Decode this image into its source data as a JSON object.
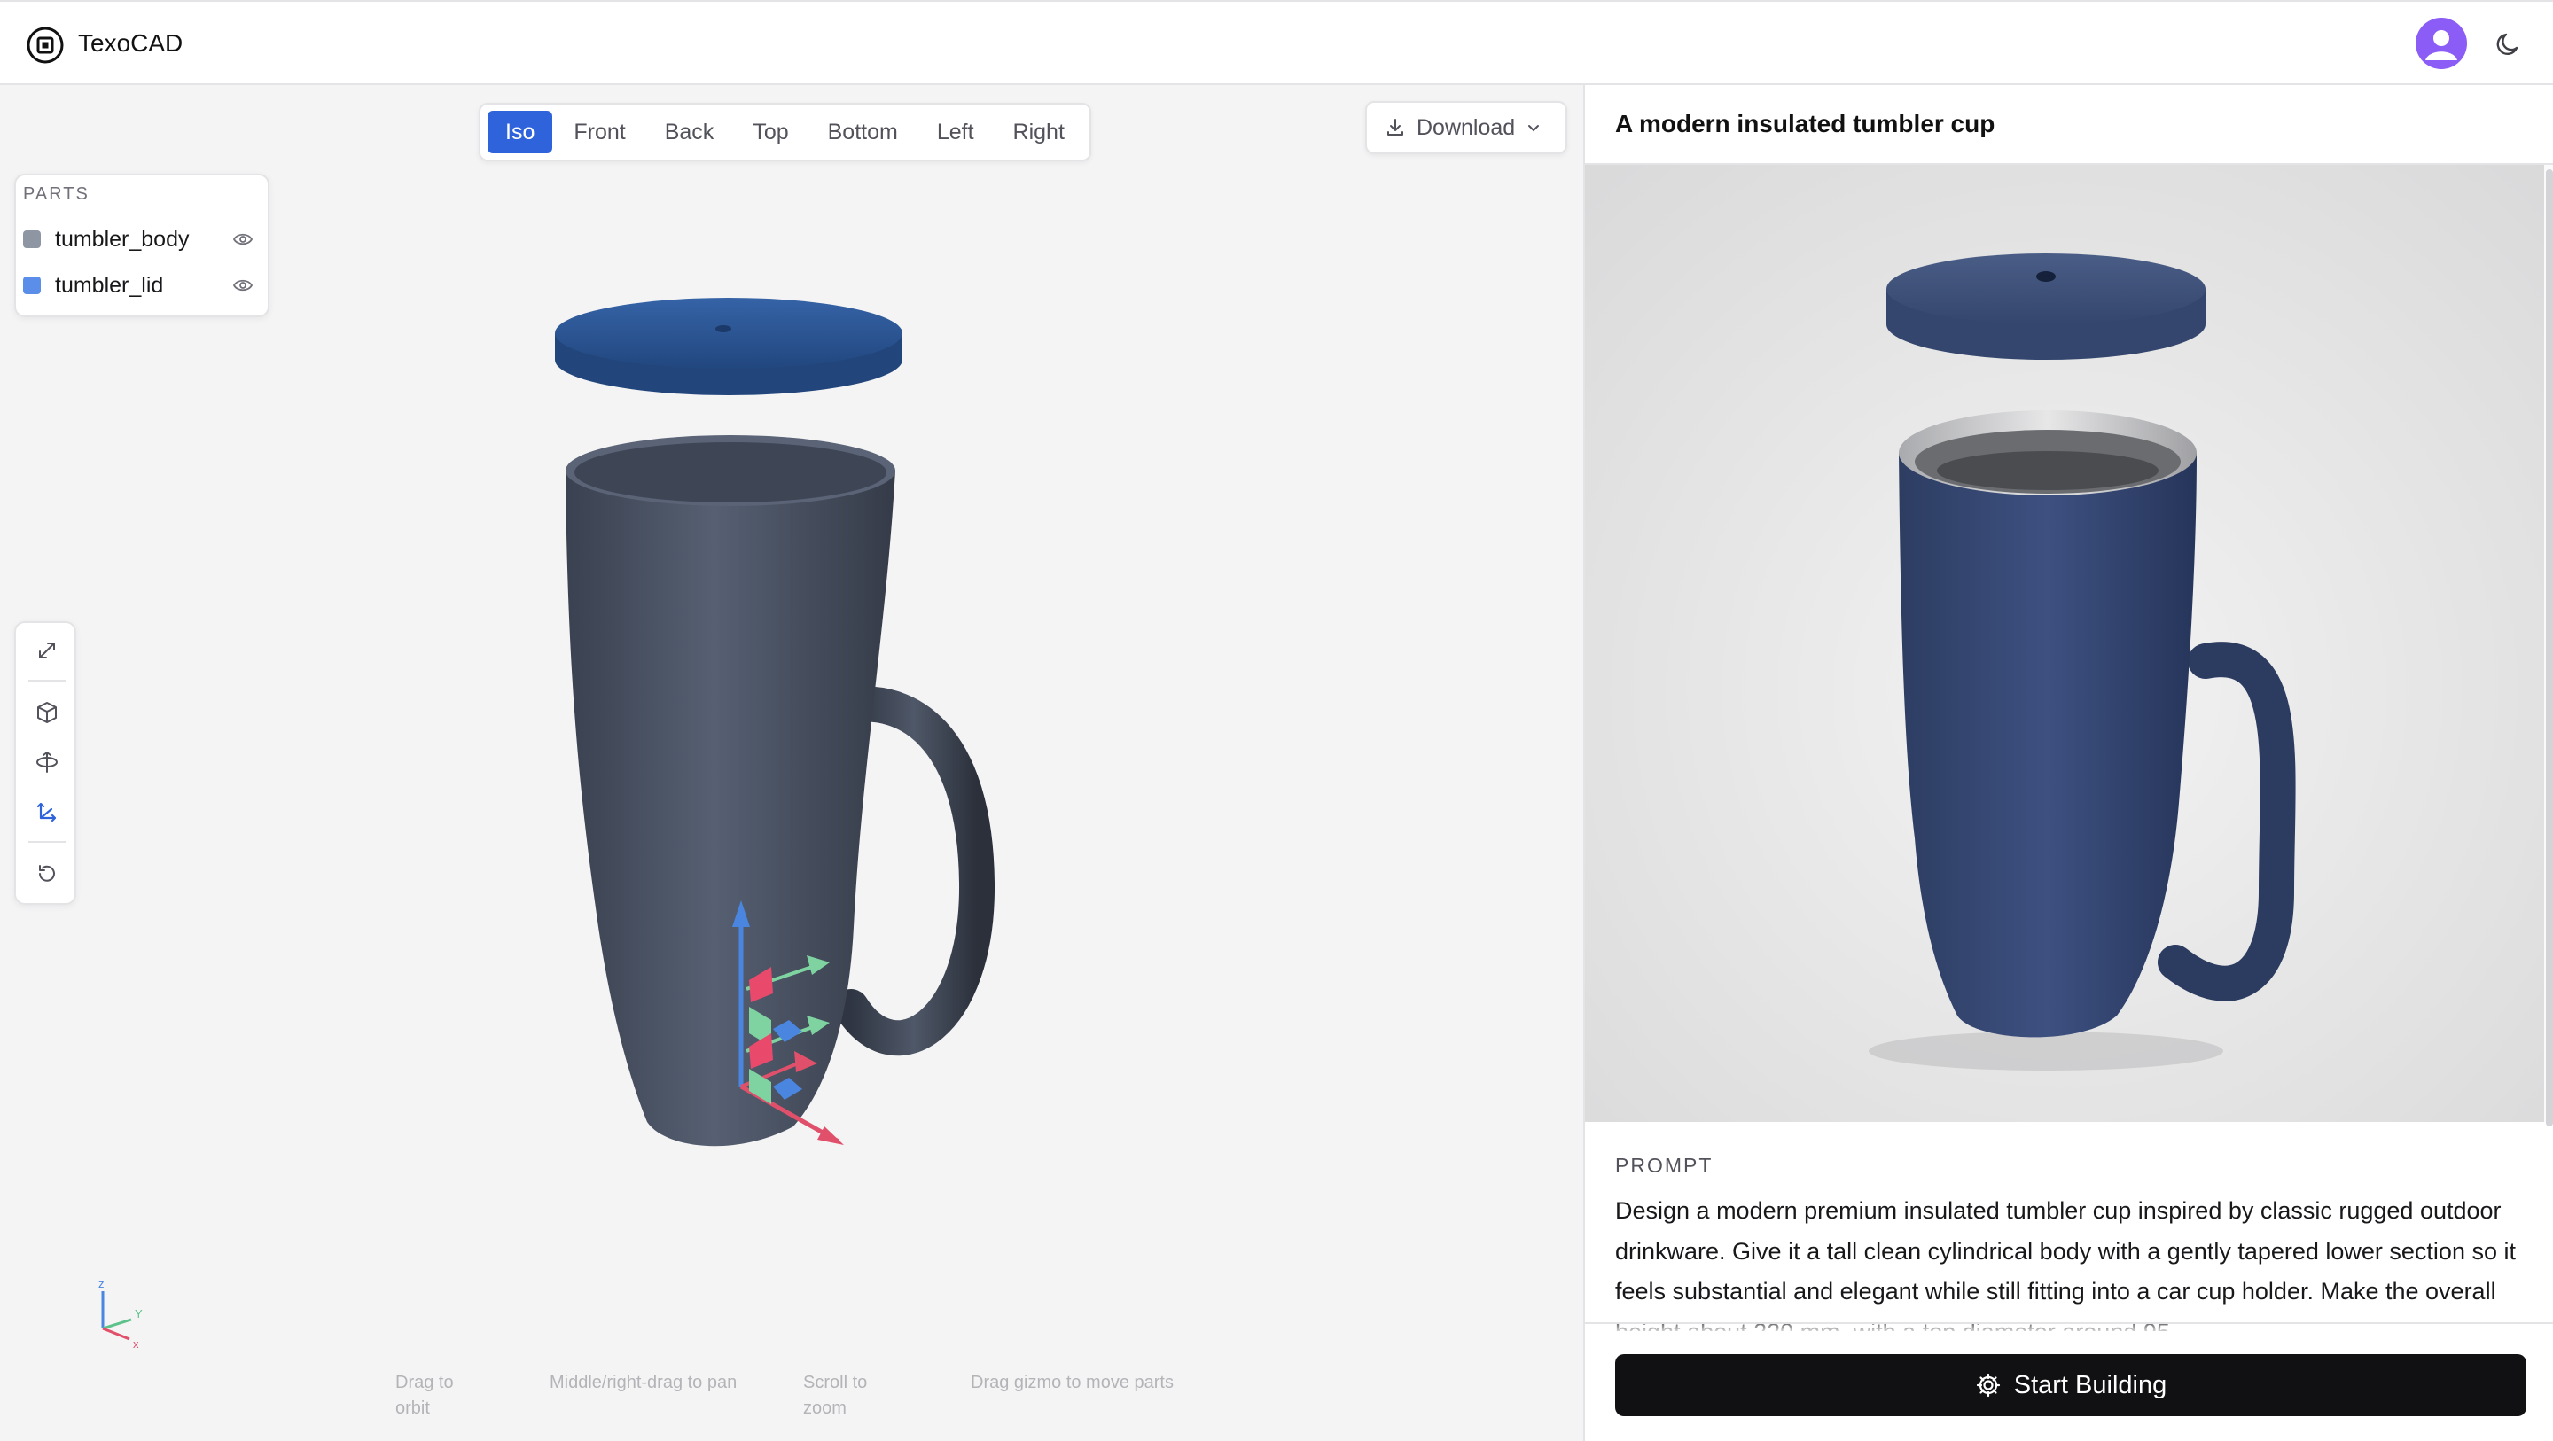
{
  "app": {
    "title": "TexoCAD",
    "logo_icon": "chip-logo-icon",
    "avatar_icon": "user-avatar-icon",
    "theme_icon": "moon-icon"
  },
  "viewport": {
    "view_tabs": [
      "Iso",
      "Front",
      "Back",
      "Top",
      "Bottom",
      "Left",
      "Right"
    ],
    "active_view": "Iso",
    "download_label": "Download",
    "parts_title": "PARTS",
    "parts": [
      {
        "name": "tumbler_body",
        "color": "#8f96a3",
        "visible": true
      },
      {
        "name": "tumbler_lid",
        "color": "#5a8ee8",
        "visible": true
      }
    ],
    "tools": [
      "expand-icon",
      "cube-icon",
      "orbit-icon",
      "axes-icon",
      "reset-icon"
    ],
    "axis_labels": {
      "z": "z",
      "y": "Y",
      "x": "x"
    },
    "hints": [
      "Drag to orbit",
      "Middle/right-drag to pan",
      "Scroll to zoom",
      "Drag gizmo to move parts"
    ],
    "colors": {
      "accent": "#2f63dc",
      "body": "#4a5263",
      "lid": "#2d5696",
      "background": "#f4f4f5"
    }
  },
  "design": {
    "title": "A modern insulated tumbler cup",
    "prompt_label": "PROMPT",
    "prompt_text": "Design a modern premium insulated tumbler cup inspired by classic rugged outdoor drinkware. Give it a tall clean cylindrical body with a gently tapered lower section so it feels substantial and elegant while still fitting into a car cup holder. Make the overall height about 220 mm, with a top diameter around 95",
    "start_button_label": "Start Building",
    "start_icon": "gear-icon"
  }
}
